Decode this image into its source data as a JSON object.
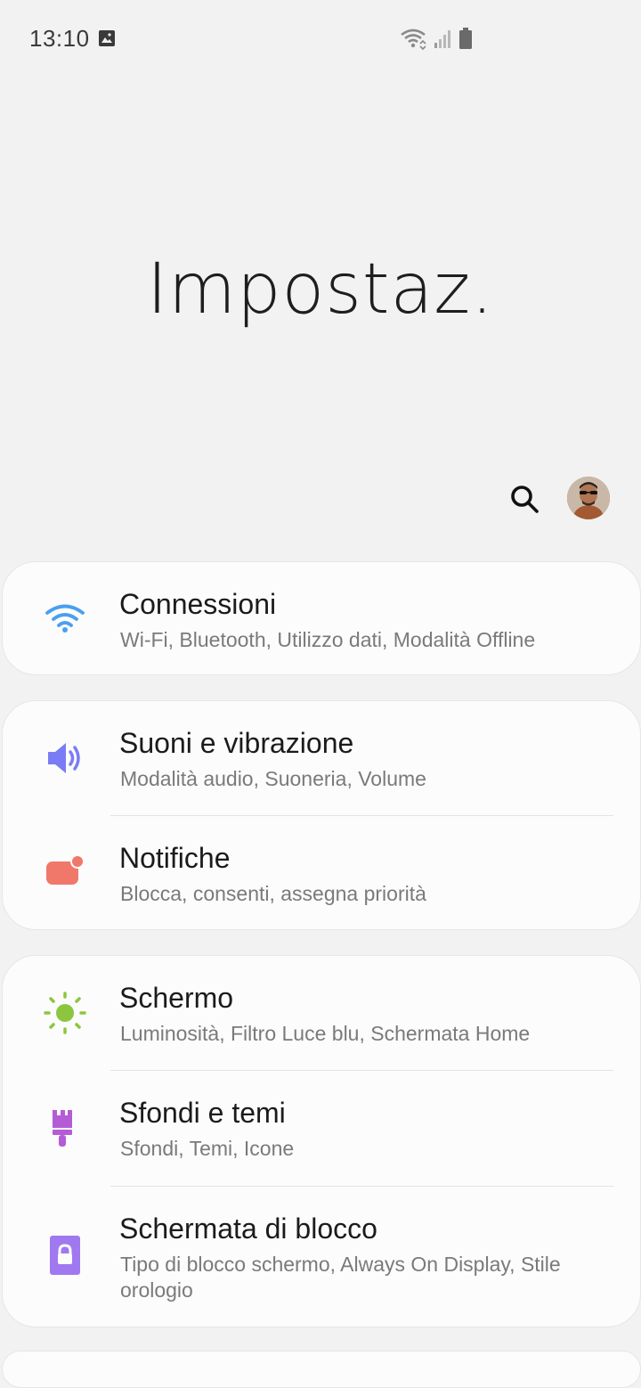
{
  "status_bar": {
    "time": "13:10",
    "icons": [
      "image-icon",
      "wifi-icon",
      "signal-icon",
      "battery-icon"
    ]
  },
  "page": {
    "title": "Impostaz."
  },
  "actions": {
    "search_icon": "search-icon",
    "avatar": "profile-avatar"
  },
  "groups": [
    {
      "items": [
        {
          "title": "Connessioni",
          "subtitle": "Wi-Fi, Bluetooth, Utilizzo dati, Modalità Offline",
          "icon": "wifi-icon",
          "color": "#4a9ff0"
        }
      ]
    },
    {
      "items": [
        {
          "title": "Suoni e vibrazione",
          "subtitle": "Modalità audio, Suoneria, Volume",
          "icon": "speaker-icon",
          "color": "#7a7cf5"
        },
        {
          "title": "Notifiche",
          "subtitle": "Blocca, consenti, assegna priorità",
          "icon": "notification-icon",
          "color": "#f0786a"
        }
      ]
    },
    {
      "items": [
        {
          "title": "Schermo",
          "subtitle": "Luminosità, Filtro Luce blu, Schermata Home",
          "icon": "brightness-icon",
          "color": "#8cc63f"
        },
        {
          "title": "Sfondi e temi",
          "subtitle": "Sfondi, Temi, Icone",
          "icon": "paintbrush-icon",
          "color": "#b45cd6"
        },
        {
          "title": "Schermata di blocco",
          "subtitle": "Tipo di blocco schermo, Always On Display, Stile orologio",
          "icon": "lock-icon",
          "color": "#a078f0"
        }
      ]
    }
  ]
}
